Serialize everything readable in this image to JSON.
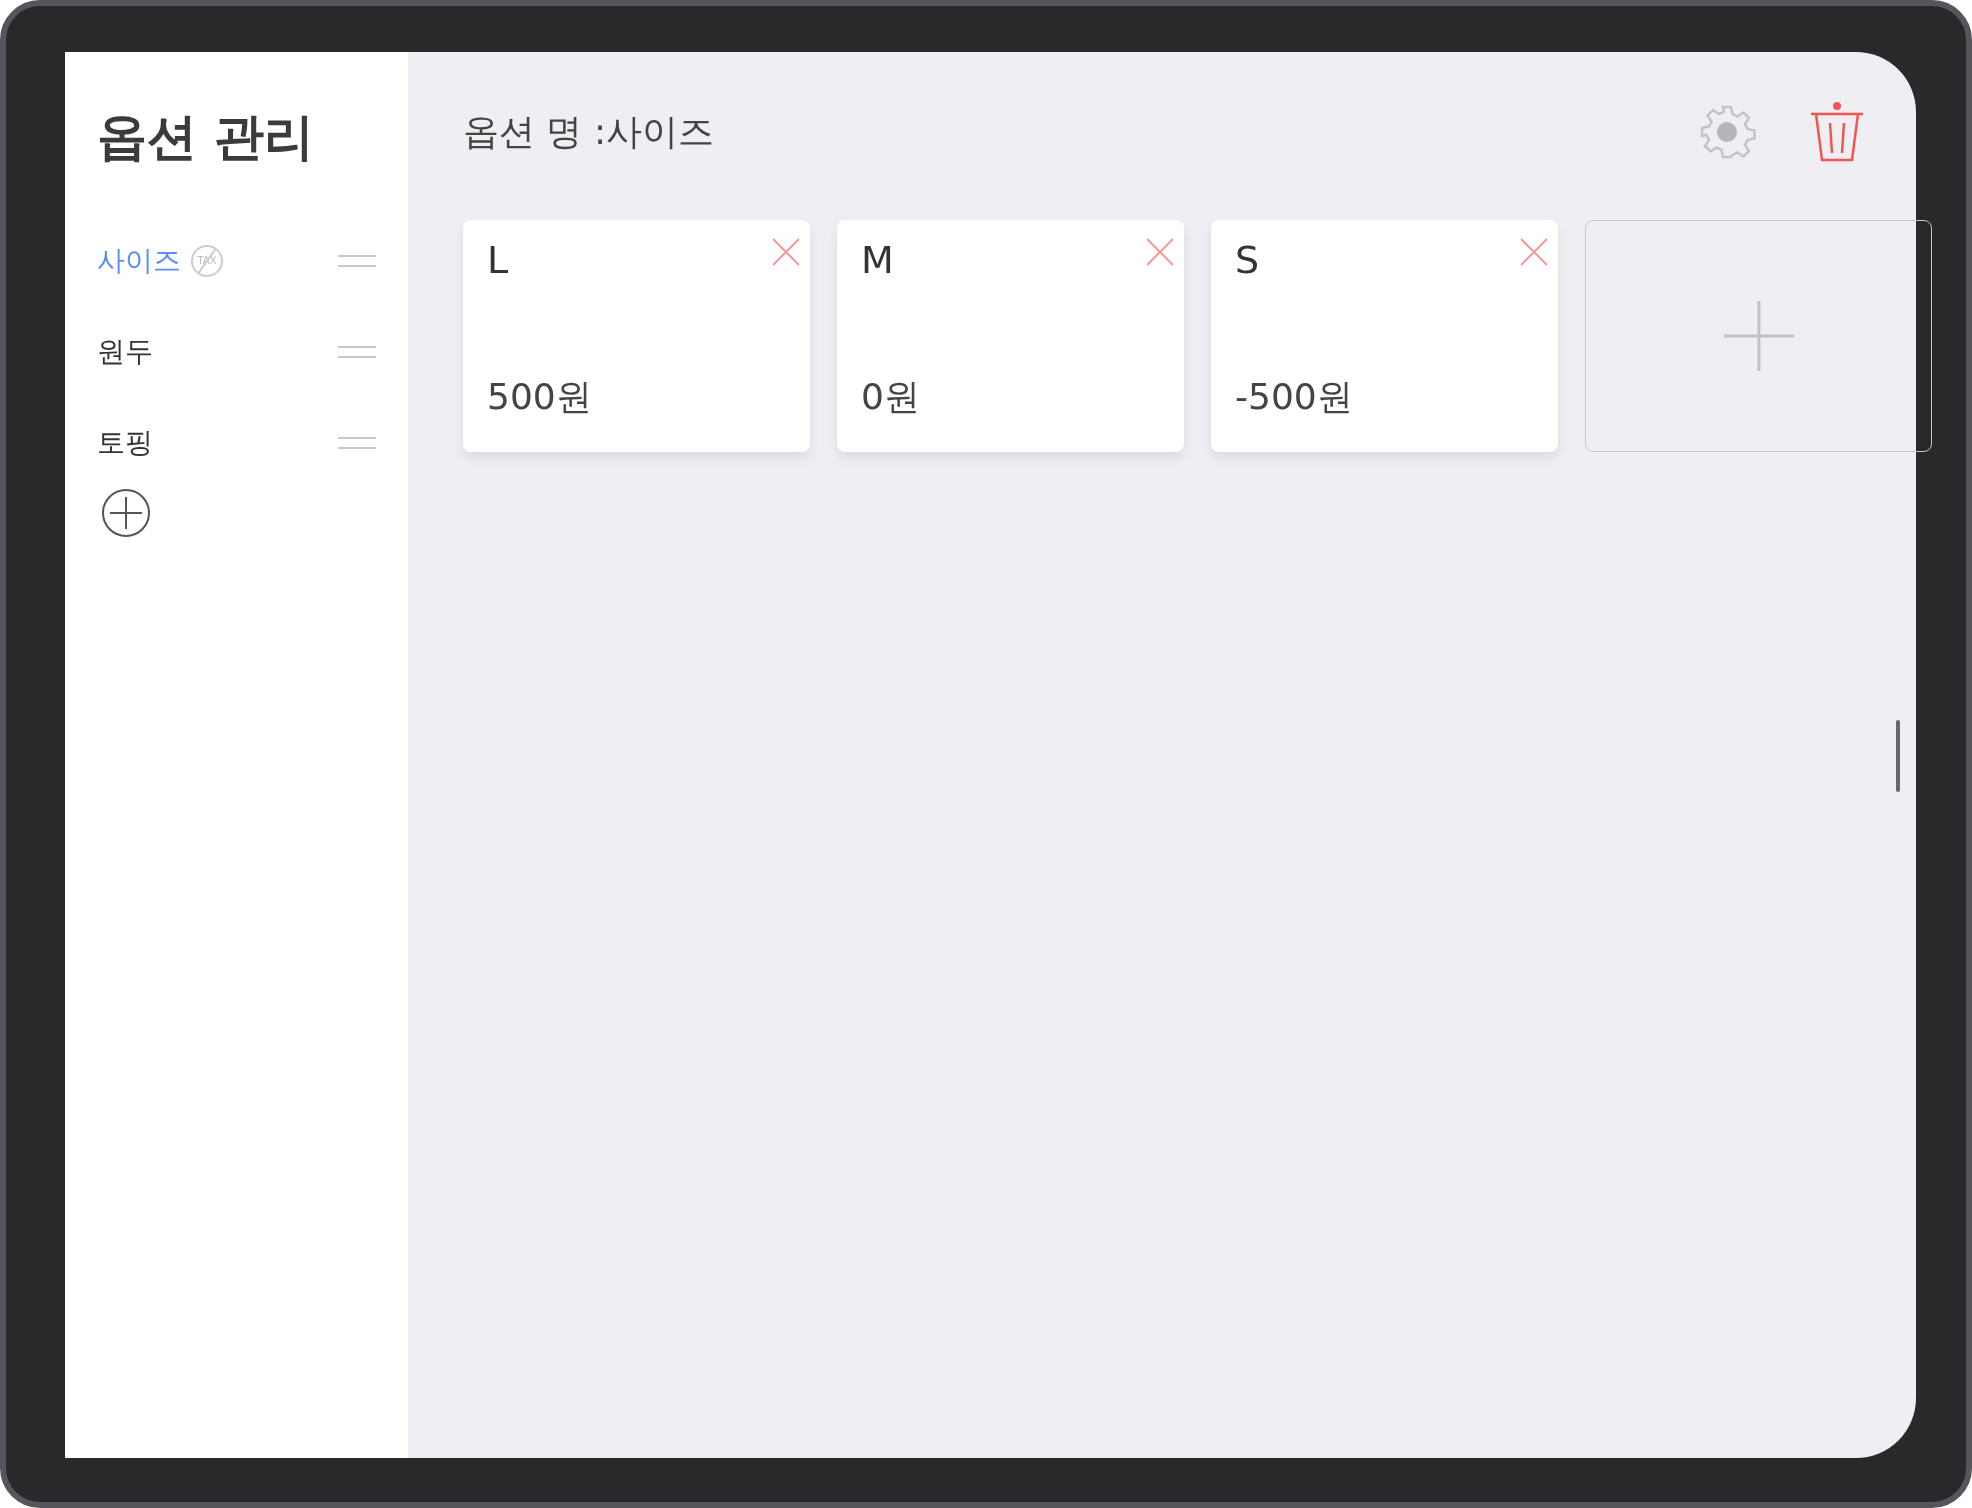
{
  "sidebar": {
    "title": "옵션 관리",
    "items": [
      {
        "label": "사이즈",
        "selected": true,
        "badge": "TAX"
      },
      {
        "label": "원두",
        "selected": false
      },
      {
        "label": "토핑",
        "selected": false
      }
    ]
  },
  "header": {
    "title": "옵션 명 :사이즈"
  },
  "options": [
    {
      "name": "L",
      "price": "500원"
    },
    {
      "name": "M",
      "price": "0원"
    },
    {
      "name": "S",
      "price": "-500원"
    }
  ]
}
